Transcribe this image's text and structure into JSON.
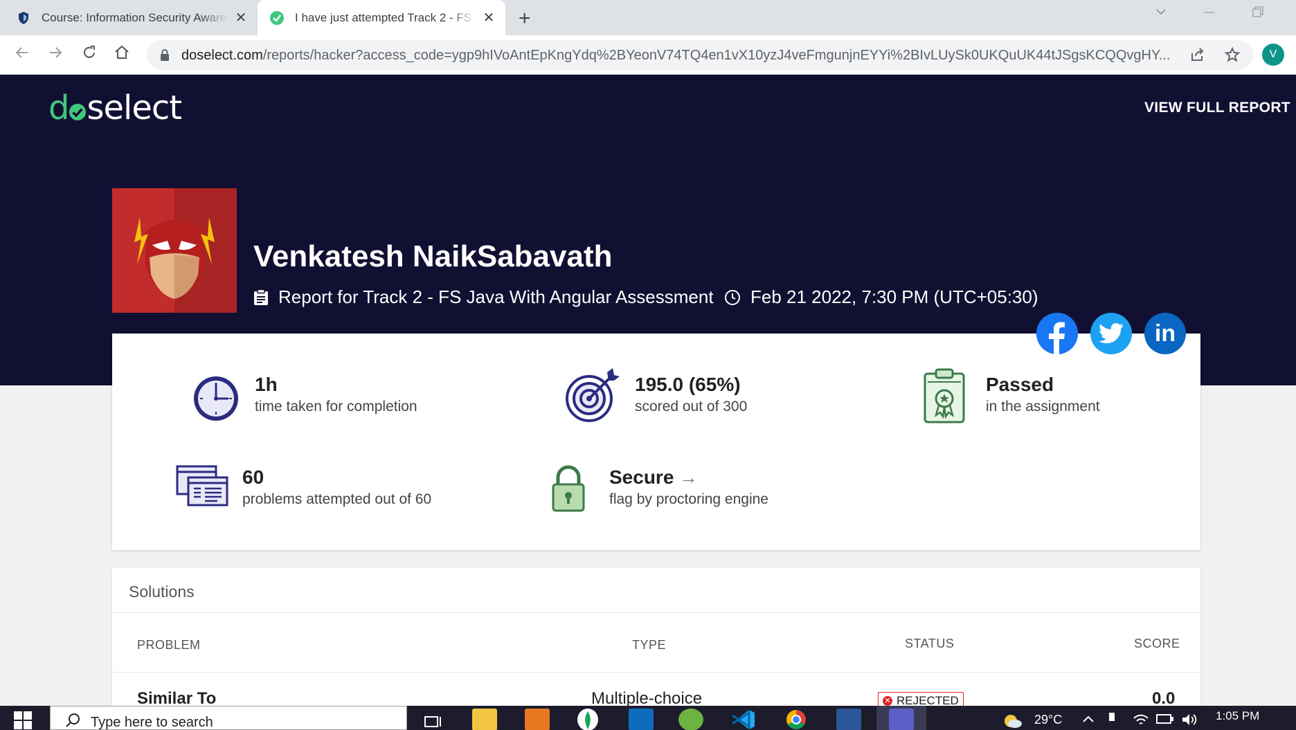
{
  "browser": {
    "tabs": [
      {
        "title": "Course: Information Security Awareness",
        "close": "✕"
      },
      {
        "title": "I have just attempted Track 2 - FS Java With Angular Assessment",
        "close": "✕"
      }
    ],
    "new_tab": "+",
    "url_host": "doselect.com",
    "url_path": "/reports/hacker?access_code=ygp9hIVoAntEpKngYdq%2BYeonV74TQ4en1vX10yzJ4veFmgunjnEYYi%2BIvLUySk0UKQuUK44tJSgsKCQQvgHY...",
    "profile_initial": "V"
  },
  "header": {
    "logo_d": "d",
    "logo_rest": "select",
    "view_full_report": "VIEW FULL REPORT"
  },
  "candidate": {
    "name": "Venkatesh NaikSabavath",
    "report_for": "Report for Track 2 - FS Java With Angular Assessment",
    "date": "Feb 21 2022, 7:30 PM (UTC+05:30)"
  },
  "social": {
    "facebook": "f",
    "linkedin": "in"
  },
  "stats": {
    "time": {
      "value": "1h",
      "desc": "time taken for completion"
    },
    "score": {
      "value": "195.0 (65%)",
      "desc": "scored out of 300"
    },
    "result": {
      "value": "Passed",
      "desc": "in the assignment"
    },
    "problems": {
      "value": "60",
      "desc": "problems attempted out of 60"
    },
    "secure": {
      "value": "Secure",
      "desc": "flag by proctoring engine",
      "arrow": "→"
    }
  },
  "solutions": {
    "title": "Solutions",
    "columns": [
      "PROBLEM",
      "TYPE",
      "STATUS",
      "SCORE"
    ],
    "rows": [
      {
        "problem": "Similar To",
        "type": "Multiple-choice",
        "status": "REJECTED",
        "score": "0.0"
      }
    ]
  },
  "taskbar": {
    "search_placeholder": "Type here to search",
    "temperature": "29°C",
    "time": "1:05 PM"
  },
  "colors": {
    "hero_bg": "#111032",
    "brand_green": "#3fc87c",
    "rejected": "#e02424",
    "icon_navy": "#2b2b80",
    "icon_green": "#3c7a4a"
  }
}
